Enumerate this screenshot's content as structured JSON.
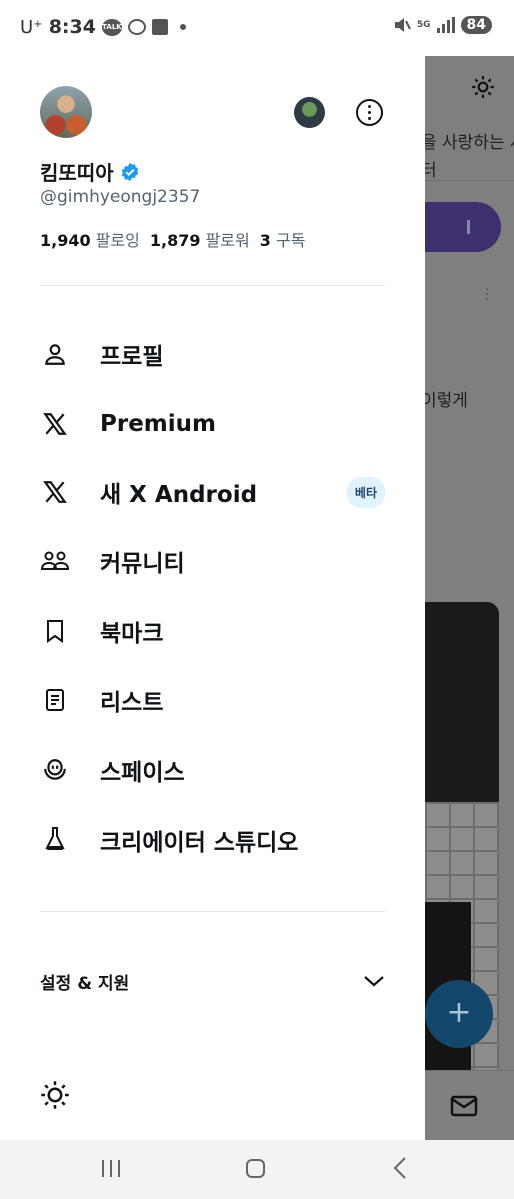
{
  "status_bar": {
    "carrier": "U⁺",
    "time": "8:34",
    "talk_icon": "TALK",
    "battery": "84",
    "network": "5G"
  },
  "background": {
    "text1": "을 사랑하는 사",
    "text2": "터",
    "text3": "이렇게"
  },
  "profile": {
    "name": "킴또띠아",
    "handle": "@gimhyeongj2357",
    "following_count": "1,940",
    "following_label": "팔로잉",
    "followers_count": "1,879",
    "followers_label": "팔로워",
    "subs_count": "3",
    "subs_label": "구독"
  },
  "menu": {
    "profile": "프로필",
    "premium": "Premium",
    "android": "새 X Android",
    "beta": "베타",
    "communities": "커뮤니티",
    "bookmarks": "북마크",
    "lists": "리스트",
    "spaces": "스페이스",
    "creator_studio": "크리에이터 스튜디오"
  },
  "settings": {
    "label": "설정 & 지원"
  },
  "colors": {
    "verified": "#1d9bf0",
    "text_primary": "#0f1419",
    "text_secondary": "#536471",
    "beta_bg": "#e0f2fc"
  }
}
